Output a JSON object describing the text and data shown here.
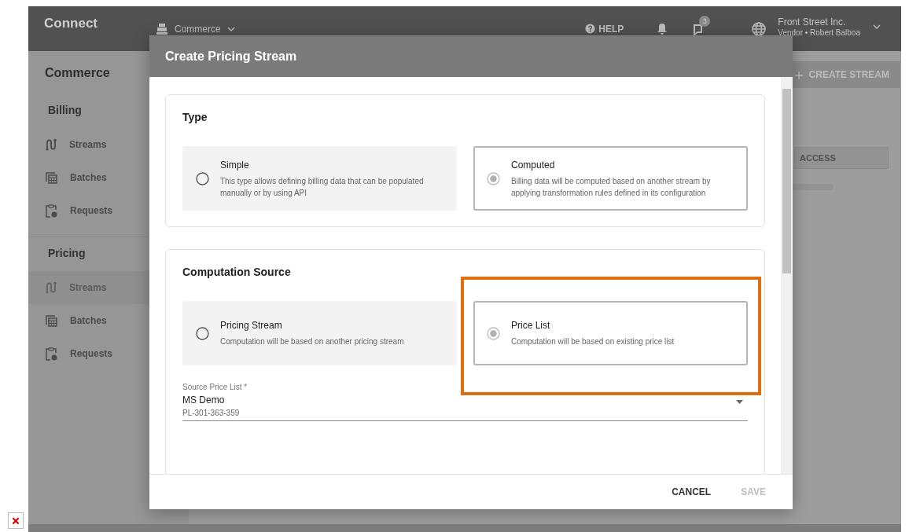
{
  "topbar": {
    "logo": "Connect",
    "module": "Commerce",
    "help": "HELP",
    "notification_count": "3",
    "account": {
      "name": "Front Street Inc.",
      "role": "Vendor • Robert Balboa"
    }
  },
  "sidebar": {
    "title": "Commerce",
    "sections": [
      {
        "title": "Billing",
        "items": [
          {
            "label": "Streams",
            "kind": "streams",
            "selected": false
          },
          {
            "label": "Batches",
            "kind": "batches",
            "selected": false
          },
          {
            "label": "Requests",
            "kind": "requests",
            "selected": false
          }
        ]
      },
      {
        "title": "Pricing",
        "items": [
          {
            "label": "Streams",
            "kind": "streams",
            "selected": true
          },
          {
            "label": "Batches",
            "kind": "batches",
            "selected": false
          },
          {
            "label": "Requests",
            "kind": "requests",
            "selected": false
          }
        ]
      }
    ]
  },
  "page": {
    "create_button": "CREATE STREAM",
    "table_column": "ACCESS"
  },
  "modal": {
    "title": "Create Pricing Stream",
    "sections": [
      {
        "title": "Type",
        "options": [
          {
            "title": "Simple",
            "description": "This type allows defining billing data that can be populated manually or by using API",
            "selected": false,
            "highlighted": false
          },
          {
            "title": "Computed",
            "description": "Billing data will be computed based on another stream by applying transformation rules defined in its configuration",
            "selected": true,
            "highlighted": false
          }
        ]
      },
      {
        "title": "Computation Source",
        "options": [
          {
            "title": "Pricing Stream",
            "description": "Computation will be based on another pricing stream",
            "selected": false,
            "highlighted": false
          },
          {
            "title": "Price List",
            "description": "Computation will be based on existing price list",
            "selected": true,
            "highlighted": true
          }
        ],
        "field": {
          "label": "Source Price List *",
          "value": "MS Demo",
          "secondary": "PL-301-363-359"
        }
      }
    ],
    "actions": [
      {
        "label": "CANCEL",
        "disabled": false
      },
      {
        "label": "SAVE",
        "disabled": true
      }
    ]
  }
}
